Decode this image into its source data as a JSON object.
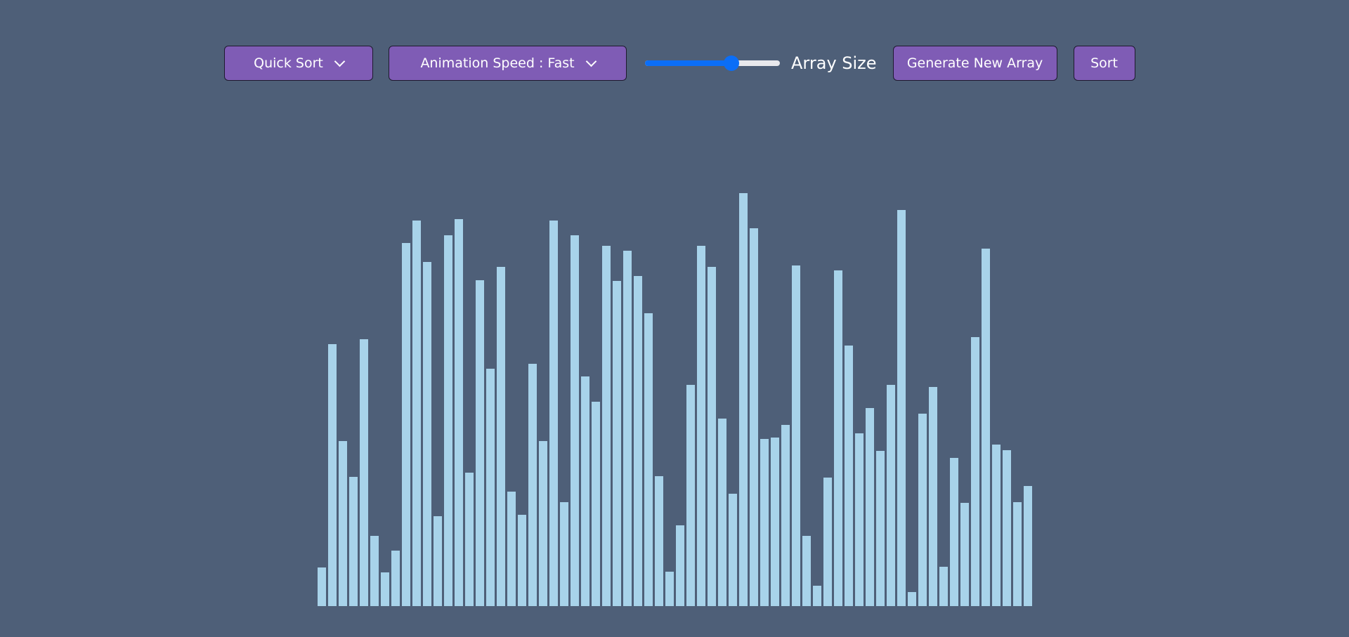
{
  "toolbar": {
    "algorithm_label": "Quick Sort",
    "speed_label": "Animation Speed : Fast",
    "array_size_label": "Array Size",
    "generate_label": "Generate New Array",
    "sort_label": "Sort",
    "icons": {
      "dropdown": "chevron-down-icon"
    }
  },
  "slider": {
    "fraction": 0.66
  },
  "colors": {
    "background": "#4e5f78",
    "button": "#7f5cb5",
    "bar": "#a8d3ea",
    "slider_accent": "#0b6ef7"
  },
  "array": {
    "max_value": 600,
    "values": [
      56,
      377,
      237,
      186,
      384,
      101,
      48,
      80,
      522,
      555,
      495,
      129,
      533,
      557,
      192,
      469,
      341,
      488,
      165,
      131,
      348,
      237,
      555,
      150,
      533,
      330,
      294,
      518,
      468,
      511,
      475,
      421,
      187,
      50,
      116,
      318,
      518,
      488,
      270,
      162,
      594,
      543,
      240,
      242,
      261,
      490,
      101,
      29,
      185,
      483,
      375,
      248,
      285,
      223,
      318,
      570,
      20,
      277,
      315,
      57,
      213,
      148,
      387,
      514,
      232,
      224,
      150,
      173
    ]
  }
}
